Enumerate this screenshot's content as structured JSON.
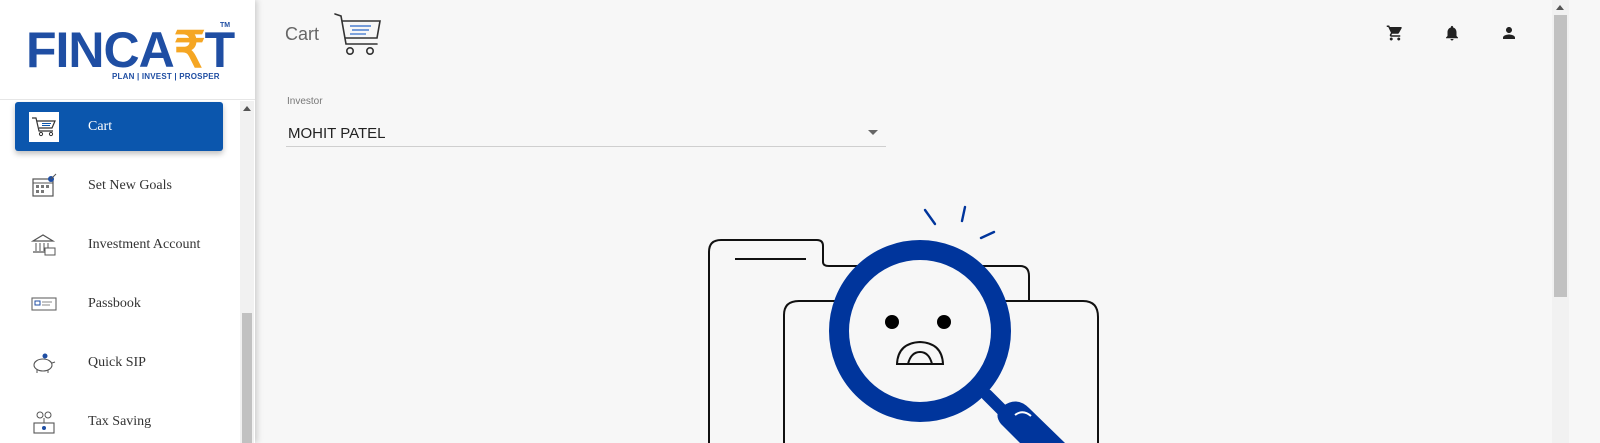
{
  "brand": {
    "logo_main": "FINCA",
    "logo_r": "₹",
    "logo_end": "T",
    "logo_tm": "TM",
    "tagline": "PLAN | INVEST | PROSPER"
  },
  "sidebar": {
    "items": [
      {
        "label": "Cart",
        "icon": "cart-icon",
        "active": true
      },
      {
        "label": "Set New Goals",
        "icon": "calendar-goal-icon",
        "active": false
      },
      {
        "label": "Investment Account",
        "icon": "bank-icon",
        "active": false
      },
      {
        "label": "Passbook",
        "icon": "passbook-icon",
        "active": false
      },
      {
        "label": "Quick SIP",
        "icon": "piggy-bank-icon",
        "active": false
      },
      {
        "label": "Tax Saving",
        "icon": "tax-saving-icon",
        "active": false
      }
    ]
  },
  "header": {
    "title": "Cart",
    "icons": [
      "cart-icon",
      "bell-icon",
      "account-icon"
    ]
  },
  "investor": {
    "label": "Investor",
    "value": "MOHIT PATEL"
  },
  "colors": {
    "brand_blue": "#0b56ad",
    "logo_blue": "#1f4ea3",
    "logo_orange": "#f5a623",
    "illustration_blue": "#00359c"
  }
}
